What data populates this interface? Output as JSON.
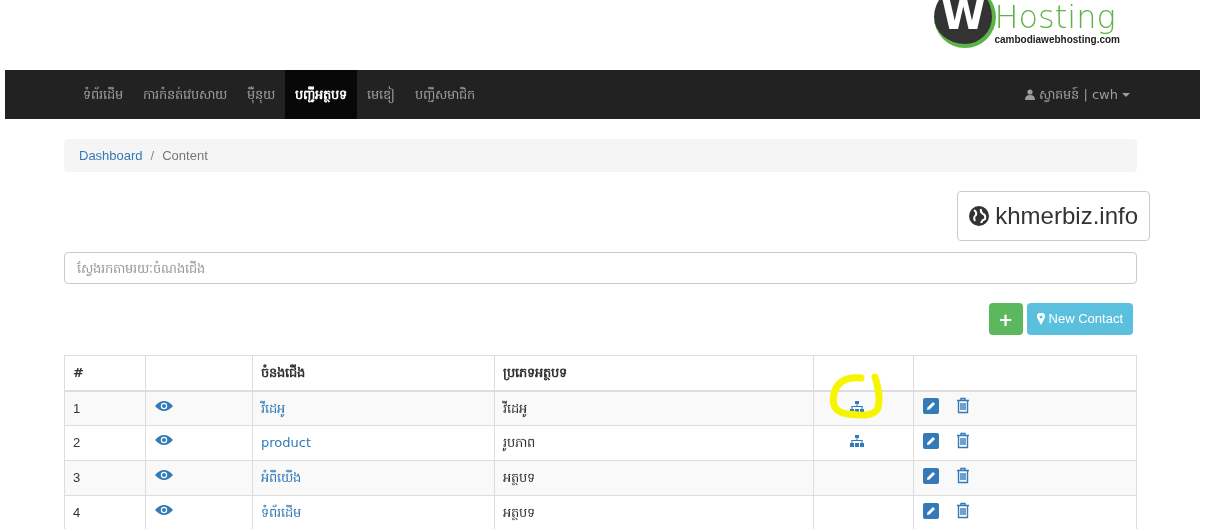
{
  "logo": {
    "mark": "W",
    "name": "Hosting",
    "domain": "cambodiawebhosting.com"
  },
  "nav": {
    "items": [
      {
        "label": "ទំព័រដើម",
        "selected": false
      },
      {
        "label": "ការកំនត់វេបសាយ",
        "selected": false
      },
      {
        "label": "ម៉ឺនុយ",
        "selected": false
      },
      {
        "label": "បញ្ជីអត្ថបទ",
        "selected": true
      },
      {
        "label": "មេឌៀ",
        "selected": false
      },
      {
        "label": "បញ្ជីសមាជិក",
        "selected": false
      }
    ],
    "user": {
      "label": "ស្វាគមន៍ | cwh"
    }
  },
  "breadcrumb": {
    "separator": "/",
    "items": [
      {
        "label": "Dashboard",
        "kind": "link"
      },
      {
        "label": "Content",
        "kind": "current"
      }
    ]
  },
  "site_button": {
    "label": "khmerbiz.info"
  },
  "search": {
    "placeholder": "ស្វែងរកតាមរយៈចំណងជើង"
  },
  "actions": {
    "add": "+",
    "new_contact": "New Contact"
  },
  "table": {
    "columns": [
      "#",
      "",
      "ចំនងជើង",
      "ប្រភេទអត្ថបទ",
      "",
      ""
    ],
    "rows": [
      {
        "index": "1",
        "title": "វីដេអូ",
        "type": "វីដេអូ",
        "hierarchy": true,
        "highlighted": true
      },
      {
        "index": "2",
        "title": "product",
        "type": "រូបភាព",
        "hierarchy": true,
        "highlighted": false
      },
      {
        "index": "3",
        "title": "អំពីយើង",
        "type": "អត្ថបទ",
        "hierarchy": false,
        "highlighted": false
      },
      {
        "index": "4",
        "title": "ទំព័រដើម",
        "type": "អត្ថបទ",
        "hierarchy": false,
        "highlighted": false
      }
    ]
  }
}
